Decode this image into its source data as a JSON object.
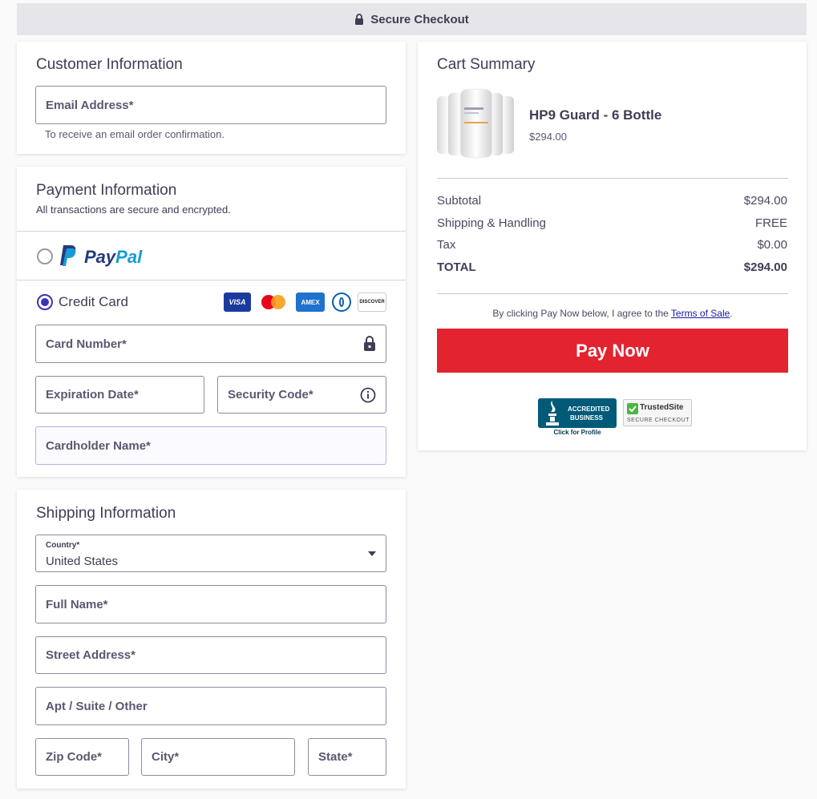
{
  "topbar": {
    "title": "Secure Checkout"
  },
  "customer": {
    "title": "Customer Information",
    "email_label": "Email Address*",
    "email_help": "To receive an email order confirmation."
  },
  "payment": {
    "title": "Payment Information",
    "subtitle": "All transactions are secure and encrypted.",
    "paypal_pay": "Pay",
    "paypal_pal": "Pal",
    "credit_card_label": "Credit Card",
    "card_brands": [
      "VISA",
      "MC",
      "AMEX",
      "DINERS",
      "DISCOVER"
    ],
    "card_number_label": "Card Number*",
    "expiration_label": "Expiration Date*",
    "security_label": "Security Code*",
    "cardholder_label": "Cardholder Name*"
  },
  "shipping": {
    "title": "Shipping Information",
    "country_label": "Country*",
    "country_value": "United States",
    "full_name_label": "Full Name*",
    "street_label": "Street Address*",
    "apt_label": "Apt / Suite / Other",
    "zip_label": "Zip Code*",
    "city_label": "City*",
    "state_label": "State*"
  },
  "cart": {
    "title": "Cart Summary",
    "product_name": "HP9 Guard - 6 Bottle",
    "product_price": "$294.00",
    "subtotal_label": "Subtotal",
    "subtotal_value": "$294.00",
    "shipping_label": "Shipping & Handling",
    "shipping_value": "FREE",
    "tax_label": "Tax",
    "tax_value": "$0.00",
    "total_label": "TOTAL",
    "total_value": "$294.00",
    "agree_text": "By clicking Pay Now below, I agree to the ",
    "terms_link": "Terms of Sale",
    "agree_end": ".",
    "pay_button": "Pay Now",
    "bbb_line1": "ACCREDITED",
    "bbb_line2": "BUSINESS",
    "bbb_sub": "Click for Profile",
    "trusted_title": "TrustedSite",
    "trusted_sub": "SECURE CHECKOUT"
  },
  "colors": {
    "accent": "#3b34b5",
    "pay": "#e3232f",
    "text": "#3f3d56"
  }
}
